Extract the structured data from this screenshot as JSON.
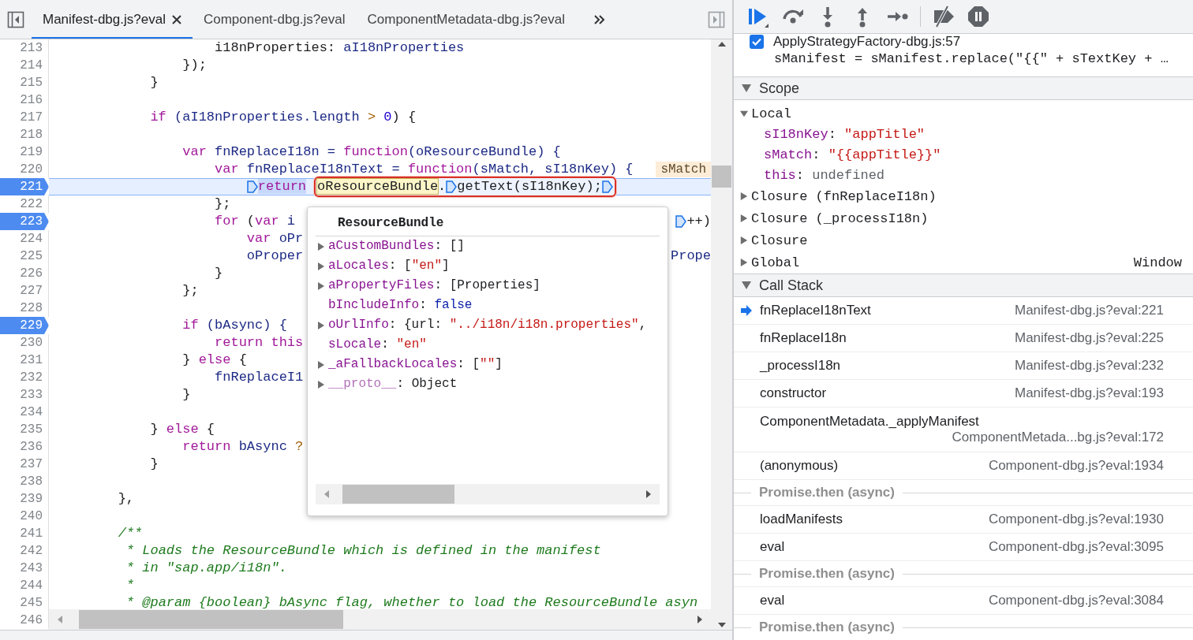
{
  "editor": {
    "tabs": [
      {
        "label": "Manifest-dbg.js?eval",
        "selected": true,
        "closable": true
      },
      {
        "label": "Component-dbg.js?eval",
        "selected": false,
        "closable": false
      },
      {
        "label": "ComponentMetadata-dbg.js?eval",
        "selected": false,
        "closable": false
      }
    ],
    "lines": [
      {
        "number": "213",
        "breakpoint": false,
        "current": false,
        "tokens": [
          {
            "text": "                    i18nProperties: ",
            "kind": "plain"
          },
          {
            "text": "aI18nProperties",
            "kind": "name"
          }
        ]
      },
      {
        "number": "214",
        "breakpoint": false,
        "current": false,
        "tokens": [
          {
            "text": "                });",
            "kind": "plain"
          }
        ]
      },
      {
        "number": "215",
        "breakpoint": false,
        "current": false,
        "tokens": [
          {
            "text": "            }",
            "kind": "plain"
          }
        ]
      },
      {
        "number": "216",
        "breakpoint": false,
        "current": false
      },
      {
        "number": "217",
        "breakpoint": false,
        "current": false,
        "tokens": [
          {
            "text": "            if",
            "kind": "kw"
          },
          {
            "text": " (aI18nProperties.length ",
            "kind": "name"
          },
          {
            "text": ">",
            "kind": "op"
          },
          {
            "text": " 0",
            "kind": "num"
          },
          {
            "text": ") {",
            "kind": "plain"
          }
        ]
      },
      {
        "number": "218",
        "breakpoint": false,
        "current": false
      },
      {
        "number": "219",
        "breakpoint": false,
        "current": false,
        "tokens": [
          {
            "text": "                var",
            "kind": "kw"
          },
          {
            "text": " fnReplaceI18n = ",
            "kind": "name"
          },
          {
            "text": "function",
            "kind": "kw"
          },
          {
            "text": "(oResourceBundle) {",
            "kind": "name"
          }
        ]
      },
      {
        "number": "220",
        "breakpoint": false,
        "current": false,
        "tokens": [
          {
            "text": "                    var",
            "kind": "kw"
          },
          {
            "text": " fnReplaceI18nText = ",
            "kind": "name"
          },
          {
            "text": "function",
            "kind": "kw"
          },
          {
            "text": "(sMatch, sI18nKey) {",
            "kind": "name"
          }
        ],
        "inline_value": "sMatch"
      },
      {
        "number": "221",
        "breakpoint": true,
        "current": true,
        "tokens": [
          {
            "text": "                        return",
            "kind": "kw-selected",
            "marker_before": true
          }
        ],
        "evaluation": [
          {
            "text": "oResourceBundle",
            "kind": "hover"
          },
          {
            "text": ".",
            "kind": "plain"
          },
          {
            "text": "getText(sI18nKey);",
            "kind": "plain",
            "marker_before": true,
            "marker_after": true
          }
        ]
      },
      {
        "number": "222",
        "breakpoint": false,
        "current": false,
        "tokens": [
          {
            "text": "                    };",
            "kind": "plain"
          }
        ]
      },
      {
        "number": "223",
        "breakpoint": true,
        "current": false,
        "tokens": [
          {
            "text": "                    for",
            "kind": "kw"
          },
          {
            "text": " (",
            "kind": "plain"
          },
          {
            "text": "var",
            "kind": "kw"
          },
          {
            "text": " i",
            "kind": "name"
          }
        ],
        "tail": [
          {
            "text": "++)",
            "kind": "plain",
            "marker_before": true
          }
        ]
      },
      {
        "number": "224",
        "breakpoint": false,
        "current": false,
        "tokens": [
          {
            "text": "                        var",
            "kind": "kw"
          },
          {
            "text": " oPr",
            "kind": "name"
          }
        ]
      },
      {
        "number": "225",
        "breakpoint": false,
        "current": false,
        "tokens": [
          {
            "text": "                        oProper",
            "kind": "name"
          }
        ],
        "tail": [
          {
            "text": "Prope",
            "kind": "name"
          }
        ]
      },
      {
        "number": "226",
        "breakpoint": false,
        "current": false,
        "tokens": [
          {
            "text": "                    }",
            "kind": "plain"
          }
        ]
      },
      {
        "number": "227",
        "breakpoint": false,
        "current": false,
        "tokens": [
          {
            "text": "                };",
            "kind": "plain"
          }
        ]
      },
      {
        "number": "228",
        "breakpoint": false,
        "current": false
      },
      {
        "number": "229",
        "breakpoint": true,
        "current": false,
        "tokens": [
          {
            "text": "                if",
            "kind": "kw"
          },
          {
            "text": " (bAsync) {",
            "kind": "name"
          }
        ]
      },
      {
        "number": "230",
        "breakpoint": false,
        "current": false,
        "tokens": [
          {
            "text": "                    return",
            "kind": "kw"
          },
          {
            "text": " this",
            "kind": "kw"
          }
        ]
      },
      {
        "number": "231",
        "breakpoint": false,
        "current": false,
        "tokens": [
          {
            "text": "                } ",
            "kind": "plain"
          },
          {
            "text": "else",
            "kind": "kw"
          },
          {
            "text": " {",
            "kind": "plain"
          }
        ]
      },
      {
        "number": "232",
        "breakpoint": false,
        "current": false,
        "tokens": [
          {
            "text": "                    fnReplaceI1",
            "kind": "name"
          }
        ]
      },
      {
        "number": "233",
        "breakpoint": false,
        "current": false,
        "tokens": [
          {
            "text": "                }",
            "kind": "plain"
          }
        ]
      },
      {
        "number": "234",
        "breakpoint": false,
        "current": false
      },
      {
        "number": "235",
        "breakpoint": false,
        "current": false,
        "tokens": [
          {
            "text": "            } ",
            "kind": "plain"
          },
          {
            "text": "else",
            "kind": "kw"
          },
          {
            "text": " {",
            "kind": "plain"
          }
        ]
      },
      {
        "number": "236",
        "breakpoint": false,
        "current": false,
        "tokens": [
          {
            "text": "                return",
            "kind": "kw"
          },
          {
            "text": " bAsync ",
            "kind": "name"
          },
          {
            "text": "?",
            "kind": "op"
          }
        ]
      },
      {
        "number": "237",
        "breakpoint": false,
        "current": false,
        "tokens": [
          {
            "text": "            }",
            "kind": "plain"
          }
        ]
      },
      {
        "number": "238",
        "breakpoint": false,
        "current": false
      },
      {
        "number": "239",
        "breakpoint": false,
        "current": false,
        "tokens": [
          {
            "text": "        },",
            "kind": "plain"
          }
        ]
      },
      {
        "number": "240",
        "breakpoint": false,
        "current": false
      },
      {
        "number": "241",
        "breakpoint": false,
        "current": false,
        "tokens": [
          {
            "text": "        /**",
            "kind": "cmt"
          }
        ]
      },
      {
        "number": "242",
        "breakpoint": false,
        "current": false,
        "tokens": [
          {
            "text": "         * Loads the ResourceBundle which is defined in the manifest",
            "kind": "cmt"
          }
        ]
      },
      {
        "number": "243",
        "breakpoint": false,
        "current": false,
        "tokens": [
          {
            "text": "         * in \"sap.app/i18n\".",
            "kind": "cmt"
          }
        ]
      },
      {
        "number": "244",
        "breakpoint": false,
        "current": false,
        "tokens": [
          {
            "text": "         *",
            "kind": "cmt"
          }
        ]
      },
      {
        "number": "245",
        "breakpoint": false,
        "current": false,
        "tokens": [
          {
            "text": "         * @param {boolean} bAsync flag, whether to load the ResourceBundle asyn",
            "kind": "cmt"
          }
        ]
      },
      {
        "number": "246",
        "breakpoint": false,
        "current": false
      }
    ],
    "popup": {
      "title": "ResourceBundle",
      "properties": [
        {
          "expandable": true,
          "key": "aCustomBundles",
          "kind": "own",
          "value": [
            {
              "text": ": []",
              "kind": "plain"
            }
          ]
        },
        {
          "expandable": true,
          "key": "aLocales",
          "kind": "own",
          "value": [
            {
              "text": ": [",
              "kind": "plain"
            },
            {
              "text": "\"en\"",
              "kind": "str"
            },
            {
              "text": "]",
              "kind": "plain"
            }
          ]
        },
        {
          "expandable": true,
          "key": "aPropertyFiles",
          "kind": "own",
          "value": [
            {
              "text": ": [Properties]",
              "kind": "plain"
            }
          ]
        },
        {
          "expandable": false,
          "key": "bIncludeInfo",
          "kind": "own",
          "value": [
            {
              "text": ": ",
              "kind": "plain"
            },
            {
              "text": "false",
              "kind": "bool"
            }
          ]
        },
        {
          "expandable": true,
          "key": "oUrlInfo",
          "kind": "own",
          "value": [
            {
              "text": ": {url: ",
              "kind": "plain"
            },
            {
              "text": "\"../i18n/i18n.properties\"",
              "kind": "str"
            },
            {
              "text": ",",
              "kind": "plain"
            }
          ]
        },
        {
          "expandable": false,
          "key": "sLocale",
          "kind": "own",
          "value": [
            {
              "text": ": ",
              "kind": "plain"
            },
            {
              "text": "\"en\"",
              "kind": "str"
            }
          ]
        },
        {
          "expandable": true,
          "key": "_aFallbackLocales",
          "kind": "own",
          "value": [
            {
              "text": ": [",
              "kind": "plain"
            },
            {
              "text": "\"\"",
              "kind": "str"
            },
            {
              "text": "]",
              "kind": "plain"
            }
          ]
        },
        {
          "expandable": true,
          "key": "__proto__",
          "kind": "internal",
          "value": [
            {
              "text": ": Object",
              "kind": "plain"
            }
          ]
        }
      ]
    }
  },
  "debugger": {
    "breakpoint": {
      "checked": true,
      "label": "ApplyStrategyFactory-dbg.js:57",
      "code": "sManifest = sManifest.replace(\"{{\" + sTextKey + …"
    },
    "scope": {
      "title": "Scope",
      "expanded": true,
      "items": [
        {
          "label": "Local",
          "expanded": true,
          "children": [
            {
              "name": "sI18nKey",
              "value": [
                {
                  "text": ": ",
                  "kind": "plain"
                },
                {
                  "text": "\"appTitle\"",
                  "kind": "str"
                }
              ]
            },
            {
              "name": "sMatch",
              "value": [
                {
                  "text": ": ",
                  "kind": "plain"
                },
                {
                  "text": "\"{{appTitle}}\"",
                  "kind": "str"
                }
              ]
            },
            {
              "name": "this",
              "value": [
                {
                  "text": ": ",
                  "kind": "plain"
                },
                {
                  "text": "undefined",
                  "kind": "undefined"
                }
              ]
            }
          ]
        },
        {
          "label": "Closure (fnReplaceI18n)",
          "expanded": false
        },
        {
          "label": "Closure (_processI18n)",
          "expanded": false
        },
        {
          "label": "Closure",
          "expanded": false
        },
        {
          "label": "Global",
          "expanded": false,
          "value": "Window"
        }
      ]
    },
    "call_stack": {
      "title": "Call Stack",
      "expanded": true,
      "frames": [
        {
          "kind": "frame",
          "name": "fnReplaceI18nText",
          "location": "Manifest-dbg.js?eval:221",
          "selected": true
        },
        {
          "kind": "frame",
          "name": "fnReplaceI18n",
          "location": "Manifest-dbg.js?eval:225",
          "selected": false
        },
        {
          "kind": "frame",
          "name": "_processI18n",
          "location": "Manifest-dbg.js?eval:232",
          "selected": false
        },
        {
          "kind": "frame",
          "name": "constructor",
          "location": "Manifest-dbg.js?eval:193",
          "selected": false
        },
        {
          "kind": "frame-wrapped",
          "name": "ComponentMetadata._applyManifest",
          "location": "ComponentMetada...bg.js?eval:172",
          "selected": false
        },
        {
          "kind": "frame",
          "name": "(anonymous)",
          "location": "Component-dbg.js?eval:1934",
          "selected": false
        },
        {
          "kind": "async",
          "name": "Promise.then (async)"
        },
        {
          "kind": "frame",
          "name": "loadManifests",
          "location": "Component-dbg.js?eval:1930",
          "selected": false
        },
        {
          "kind": "frame",
          "name": "eval",
          "location": "Component-dbg.js?eval:3095",
          "selected": false
        },
        {
          "kind": "async",
          "name": "Promise.then (async)"
        },
        {
          "kind": "frame",
          "name": "eval",
          "location": "Component-dbg.js?eval:3084",
          "selected": false
        },
        {
          "kind": "async",
          "name": "Promise.then (async)"
        }
      ]
    }
  }
}
